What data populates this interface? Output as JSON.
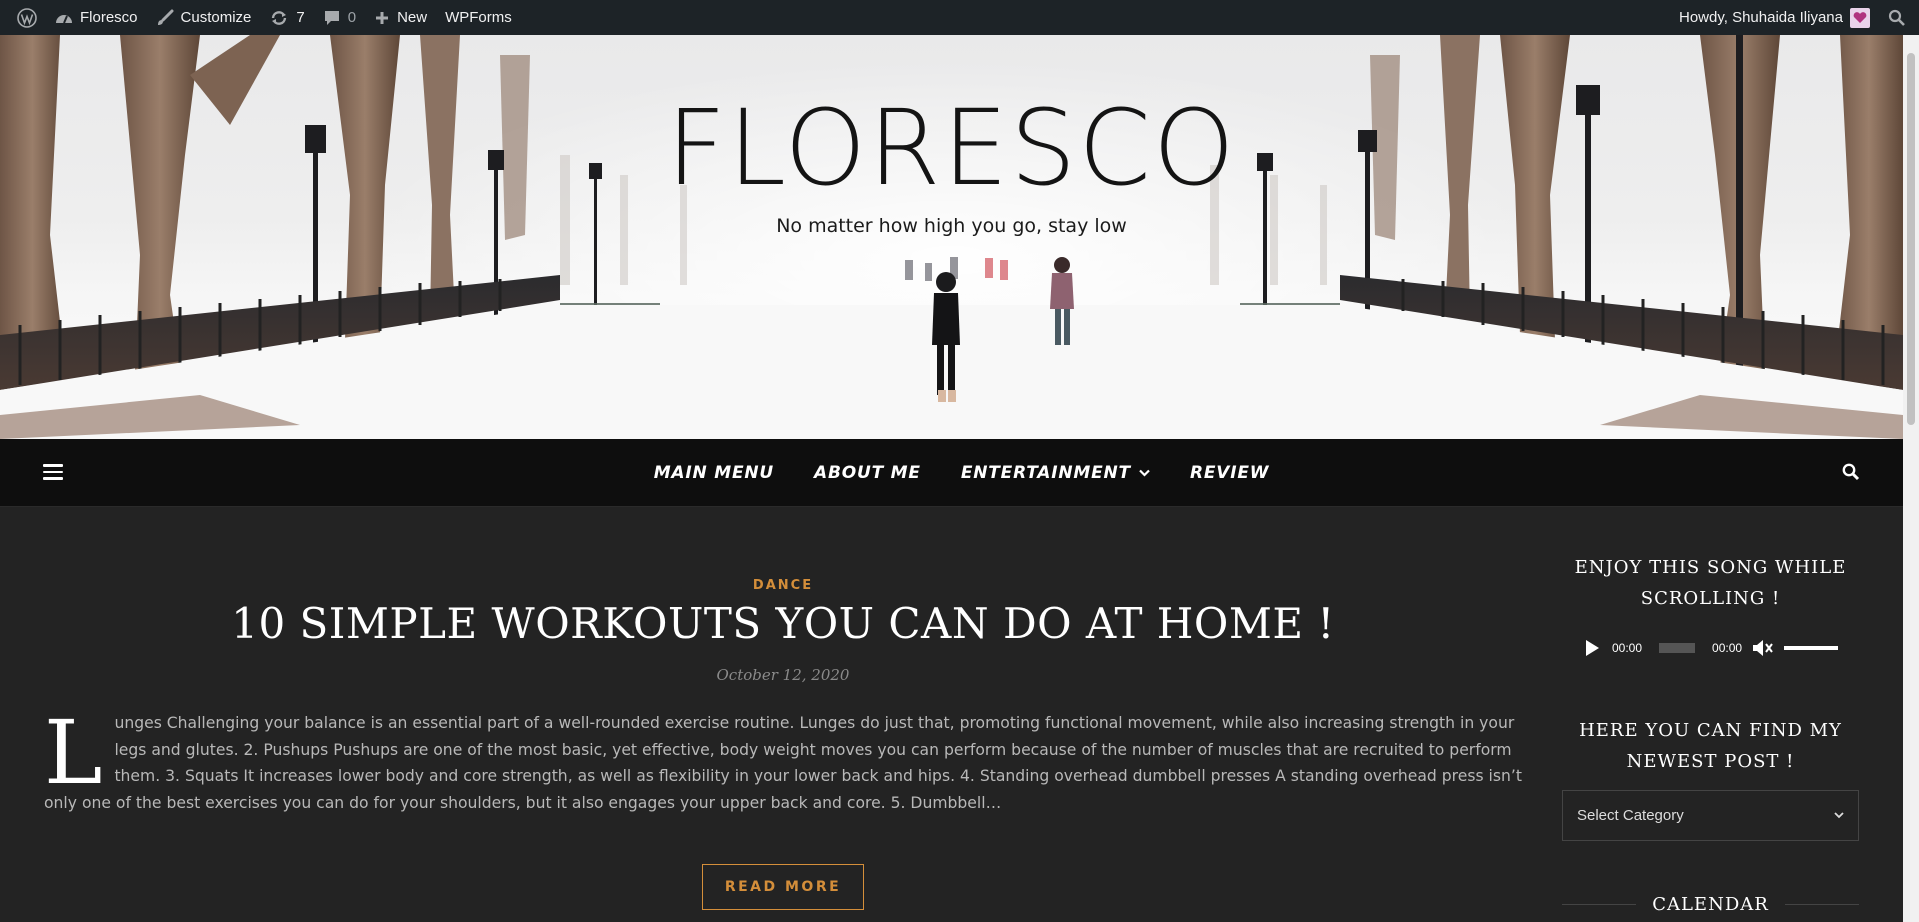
{
  "adminbar": {
    "site_name": "Floresco",
    "customize": "Customize",
    "updates_count": "7",
    "comments_count": "0",
    "new": "New",
    "wpforms": "WPForms",
    "howdy": "Howdy, Shuhaida Iliyana",
    "icons": [
      "wordpress-logo-icon",
      "dashboard-icon",
      "brush-icon",
      "refresh-icon",
      "comment-icon",
      "plus-icon",
      "avatar-icon",
      "search-icon"
    ]
  },
  "header": {
    "title": "FLORESCO",
    "tagline": "No matter how high you go, stay low"
  },
  "nav": {
    "items": [
      "MAIN MENU",
      "ABOUT ME",
      "ENTERTAINMENT",
      "REVIEW"
    ],
    "icons": [
      "hamburger-icon",
      "chevron-down-icon",
      "search-icon"
    ]
  },
  "post": {
    "category": "DANCE",
    "title": "10 SIMPLE WORKOUTS YOU CAN DO AT HOME !",
    "date": "October 12, 2020",
    "dropcap": "L",
    "excerpt": "unges Challenging your balance is an essential part of a well-rounded exercise routine. Lunges do just that, promoting functional movement, while also increasing strength in your legs and glutes. 2. Pushups Pushups are one of the most basic, yet effective, body weight moves you can perform because of the number of muscles that are recruited to perform them. 3. Squats It increases lower body and core strength, as well as flexibility in your lower back and hips. 4. Standing overhead dumbbell presses A standing overhead press isn’t only one of the best exercises you can do for your shoulders, but it also engages your upper back and core. 5. Dumbbell…",
    "read_more": "READ MORE"
  },
  "sidebar": {
    "song_widget_title": "ENJOY THIS SONG WHILE SCROLLING !",
    "audio_current_time": "00:00",
    "audio_duration": "00:00",
    "posts_widget_title": "HERE YOU CAN FIND MY NEWEST POST !",
    "category_select": "Select Category",
    "calendar_title": "CALENDAR"
  },
  "colors": {
    "accent": "#d48e3a",
    "adminbar_bg": "#1d2327",
    "nav_bg": "#0e0e0e",
    "body_bg": "#232323"
  }
}
